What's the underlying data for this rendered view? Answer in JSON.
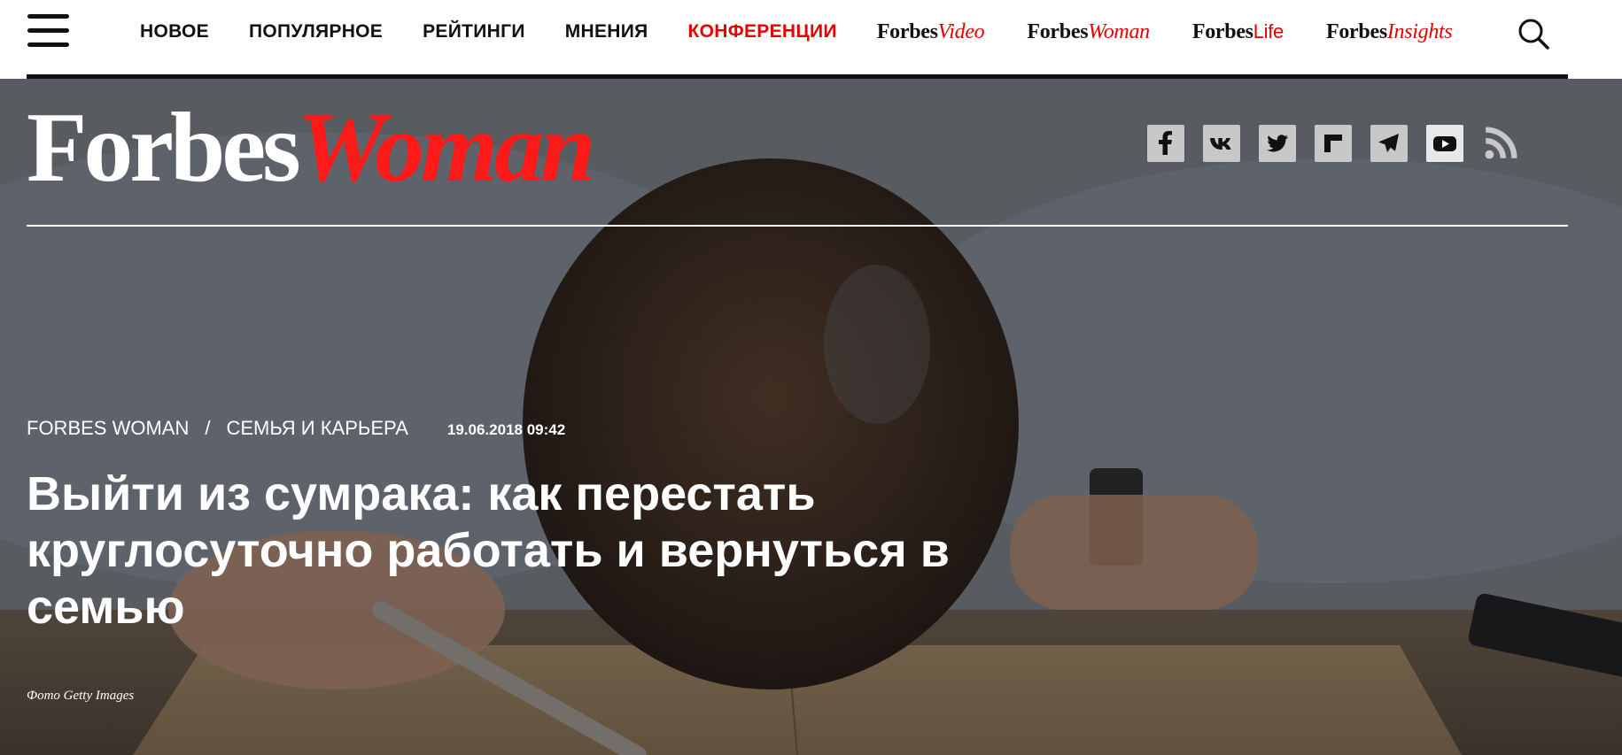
{
  "nav": {
    "links": [
      "НОВОЕ",
      "ПОПУЛЯРНОЕ",
      "РЕЙТИНГИ",
      "МНЕНИЯ",
      "КОНФЕРЕНЦИИ"
    ],
    "brands": [
      {
        "prefix": "Forbes",
        "suffix": "Video"
      },
      {
        "prefix": "Forbes",
        "suffix": "Woman"
      },
      {
        "prefix": "Forbes",
        "suffix": "Life"
      },
      {
        "prefix": "Forbes",
        "suffix": "Insights"
      }
    ],
    "accent_color": "#e60000"
  },
  "hero": {
    "logo": {
      "forbes": "Forbes",
      "woman": "Woman"
    },
    "social_icons": [
      "facebook-icon",
      "vk-icon",
      "twitter-icon",
      "flipboard-icon",
      "telegram-icon",
      "youtube-icon",
      "rss-icon"
    ],
    "breadcrumb": {
      "section": "FORBES WOMAN",
      "separator": "/",
      "subsection": "СЕМЬЯ И КАРЬЕРА"
    },
    "date": "19.06.2018 09:42",
    "headline": "Выйти из сумрака: как перестать круглосуточно работать и вернуться в семью",
    "photo_credit": "Фото Getty Images"
  }
}
